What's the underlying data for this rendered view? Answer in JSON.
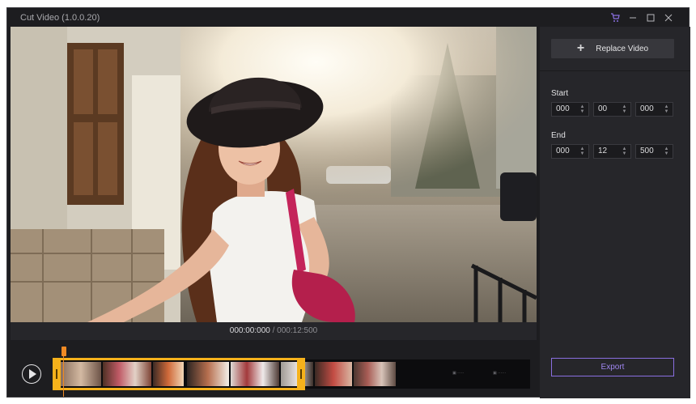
{
  "window": {
    "title": "Cut Video (1.0.0.20)",
    "controls": [
      "cart-icon",
      "minimize-icon",
      "maximize-icon",
      "close-icon"
    ]
  },
  "player": {
    "current_time": "000:00:000",
    "separator": " / ",
    "total_time": "000:12:500"
  },
  "timeline": {
    "play_icon": "play-icon",
    "selection_color": "#f6b21b",
    "playhead_color": "#f08a24"
  },
  "panel": {
    "replace_label": "Replace Video",
    "start": {
      "label": "Start",
      "fields": [
        "000",
        "00",
        "000"
      ]
    },
    "end": {
      "label": "End",
      "fields": [
        "000",
        "12",
        "500"
      ]
    },
    "export_label": "Export",
    "accent": "#8a6fe0"
  }
}
